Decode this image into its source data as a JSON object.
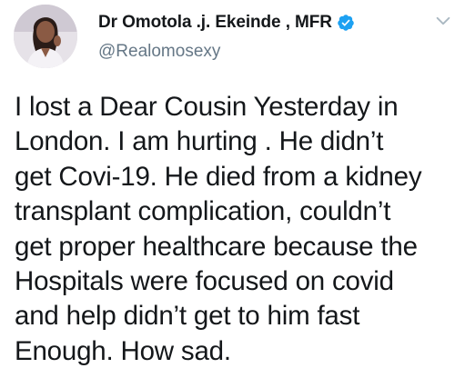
{
  "tweet": {
    "author": {
      "display_name": "Dr Omotola .j. Ekeinde , MFR",
      "handle": "@Realomosexy",
      "verified": true,
      "avatar_icon": "profile-photo"
    },
    "menu_icon": "chevron-down-icon",
    "text": "I lost a Dear Cousin Yesterday in\nLondon. I am hurting . He didn’t\nget Covi-19. He died from a kidney\ntransplant complication, couldn’t\nget proper healthcare because the\nHospitals were focused on covid\nand help didn’t get to him fast\nEnough. How sad."
  },
  "colors": {
    "text_primary": "#14171a",
    "text_secondary": "#657786",
    "verified_badge": "#1da1f2",
    "chevron": "#aab8c2"
  }
}
